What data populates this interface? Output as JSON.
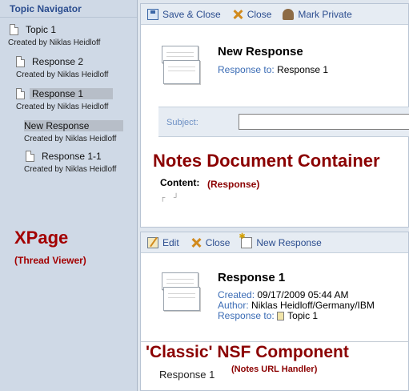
{
  "sidebar": {
    "header": "Topic Navigator",
    "items": [
      {
        "title": "Topic 1",
        "sub": "Created by Niklas Heidloff",
        "icon": "document-icon"
      },
      {
        "title": "Response 2",
        "sub": "Created by Niklas Heidloff",
        "icon": "document-icon"
      },
      {
        "title": "Response 1",
        "sub": "Created by Niklas Heidloff",
        "icon": "document-icon"
      },
      {
        "title": "New Response",
        "sub": "Created by Niklas Heidloff"
      },
      {
        "title": "Response 1-1",
        "sub": "Created by Niklas Heidloff",
        "icon": "document-icon"
      }
    ],
    "xpage_title": "XPage",
    "xpage_sub": "(Thread Viewer)"
  },
  "top_panel": {
    "toolbar": {
      "save_close": "Save & Close",
      "close": "Close",
      "mark_private": "Mark Private"
    },
    "doc_title": "New Response",
    "response_to_label": "Response to:",
    "response_to_value": "Response 1",
    "subject_label": "Subject:",
    "subject_value": "",
    "container_title": "Notes Document Container",
    "content_label": "Content:",
    "content_hint": "(Response)",
    "content_marks": "┌ ┘"
  },
  "bottom_panel": {
    "toolbar": {
      "edit": "Edit",
      "close": "Close",
      "new_response": "New Response"
    },
    "doc_title": "Response 1",
    "created_label": "Created:",
    "created_value": "09/17/2009 05:44 AM",
    "author_label": "Author:",
    "author_value": "Niklas Heidloff/Germany/IBM",
    "response_to_label": "Response to:",
    "response_to_value": "Topic 1",
    "classic_title": "'Classic' NSF Component",
    "classic_sub": "(Notes URL Handler)",
    "response_text": "Response 1"
  },
  "colors": {
    "accent_blue": "#2b4d8f",
    "label_red": "#8b0000",
    "sidebar_bg": "#cfd9e6"
  }
}
